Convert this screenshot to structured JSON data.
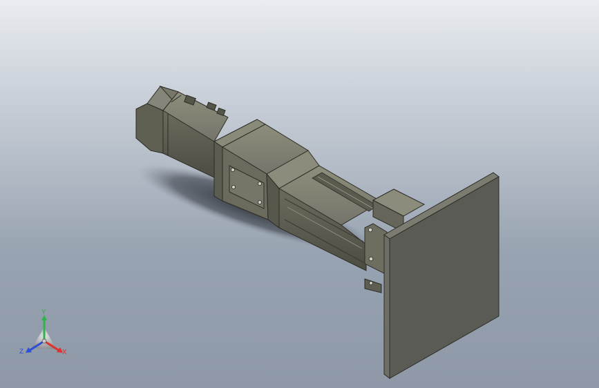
{
  "viewport": {
    "background_top": "#e9ecf0",
    "background_bottom": "#8e98a6"
  },
  "model": {
    "body_color": "#6d6d5e",
    "body_dark": "#505045",
    "body_light": "#8a8a78",
    "plate_color": "#5b5b55",
    "plate_edge": "#7b7b70"
  },
  "triad": {
    "x_label": "X",
    "y_label": "Y",
    "z_label": "Z",
    "x_color": "#e03030",
    "y_color": "#2fb34a",
    "z_color": "#2d4fd8"
  }
}
